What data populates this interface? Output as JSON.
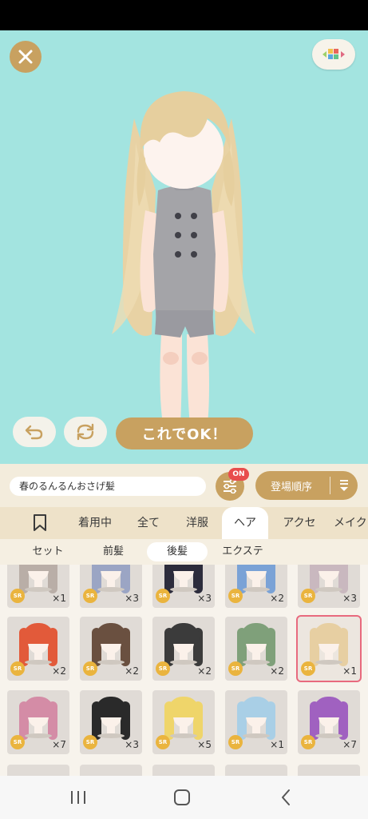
{
  "stage": {
    "background": "#a3e4e0"
  },
  "buttons": {
    "ok_label": "これでOK！"
  },
  "item_name": "春のるんるんおさげ髪",
  "filter_badge": "ON",
  "sort_label": "登場順序",
  "tabs": [
    {
      "id": "bookmark",
      "label": ""
    },
    {
      "id": "wearing",
      "label": "着用中"
    },
    {
      "id": "all",
      "label": "全て"
    },
    {
      "id": "clothes",
      "label": "洋服"
    },
    {
      "id": "hair",
      "label": "ヘア",
      "active": true
    },
    {
      "id": "accessory",
      "label": "アクセ"
    },
    {
      "id": "makeup",
      "label": "メイク"
    }
  ],
  "subtabs": [
    {
      "id": "set",
      "label": "セット"
    },
    {
      "id": "bangs",
      "label": "前髪"
    },
    {
      "id": "back-hair",
      "label": "後髪",
      "active": true
    },
    {
      "id": "extension",
      "label": "エクステ"
    }
  ],
  "rarity_label": "SR",
  "items": [
    {
      "row": 0,
      "col": 0,
      "count": "×1",
      "hair": "#b9aea7"
    },
    {
      "row": 0,
      "col": 1,
      "count": "×3",
      "hair": "#9ba5c4"
    },
    {
      "row": 0,
      "col": 2,
      "count": "×3",
      "hair": "#2c2c3c"
    },
    {
      "row": 0,
      "col": 3,
      "count": "×2",
      "hair": "#7aa2d6"
    },
    {
      "row": 0,
      "col": 4,
      "count": "×3",
      "hair": "#c9b8bf"
    },
    {
      "row": 1,
      "col": 0,
      "count": "×2",
      "hair": "#e25a3a"
    },
    {
      "row": 1,
      "col": 1,
      "count": "×2",
      "hair": "#6a5040"
    },
    {
      "row": 1,
      "col": 2,
      "count": "×2",
      "hair": "#3b3b3b"
    },
    {
      "row": 1,
      "col": 3,
      "count": "×2",
      "hair": "#7fa07a"
    },
    {
      "row": 1,
      "col": 4,
      "count": "×1",
      "hair": "#e7cfa2",
      "selected": true
    },
    {
      "row": 2,
      "col": 0,
      "count": "×7",
      "hair": "#d48ca6"
    },
    {
      "row": 2,
      "col": 1,
      "count": "×3",
      "hair": "#2a2a2a"
    },
    {
      "row": 2,
      "col": 2,
      "count": "×5",
      "hair": "#efd56a"
    },
    {
      "row": 2,
      "col": 3,
      "count": "×1",
      "hair": "#a9cfe6"
    },
    {
      "row": 2,
      "col": 4,
      "count": "×7",
      "hair": "#a061c0"
    }
  ],
  "colors": {
    "accent_gold": "#c8a160",
    "badge_red": "#e84d4d",
    "rarity_gold": "#eab43e",
    "selected_outline": "#e86a7e"
  },
  "icons": {
    "close": "close-icon",
    "palette": "palette-icon",
    "undo": "undo-icon",
    "reset": "reset-icon",
    "filter": "filter-sliders-icon",
    "sort": "sort-icon",
    "bookmark": "bookmark-icon",
    "recent_apps": "recent-apps-icon",
    "home": "home-icon",
    "back": "back-icon"
  }
}
